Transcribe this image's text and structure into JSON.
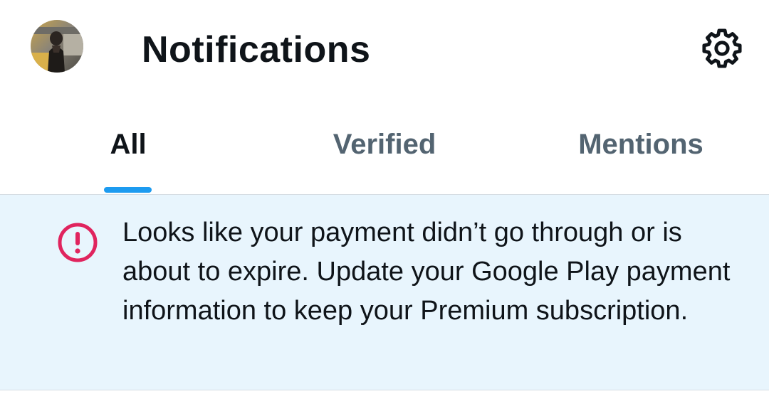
{
  "header": {
    "avatar_alt": "Profile avatar",
    "title": "Notifications",
    "settings_icon": "gear-icon"
  },
  "tabs": [
    {
      "label": "All",
      "active": true
    },
    {
      "label": "Verified",
      "active": false
    },
    {
      "label": "Mentions",
      "active": false
    }
  ],
  "alert": {
    "icon": "alert-circle-icon",
    "message": "Looks like your payment didn’t go through or is about to expire. Update your Google Play payment information to keep your Premium subscription."
  },
  "colors": {
    "accent": "#1d9bf0",
    "alert_bg": "#e8f5fd",
    "alert_icon": "#e0245e",
    "text_primary": "#0f1419",
    "text_secondary": "#536471"
  }
}
